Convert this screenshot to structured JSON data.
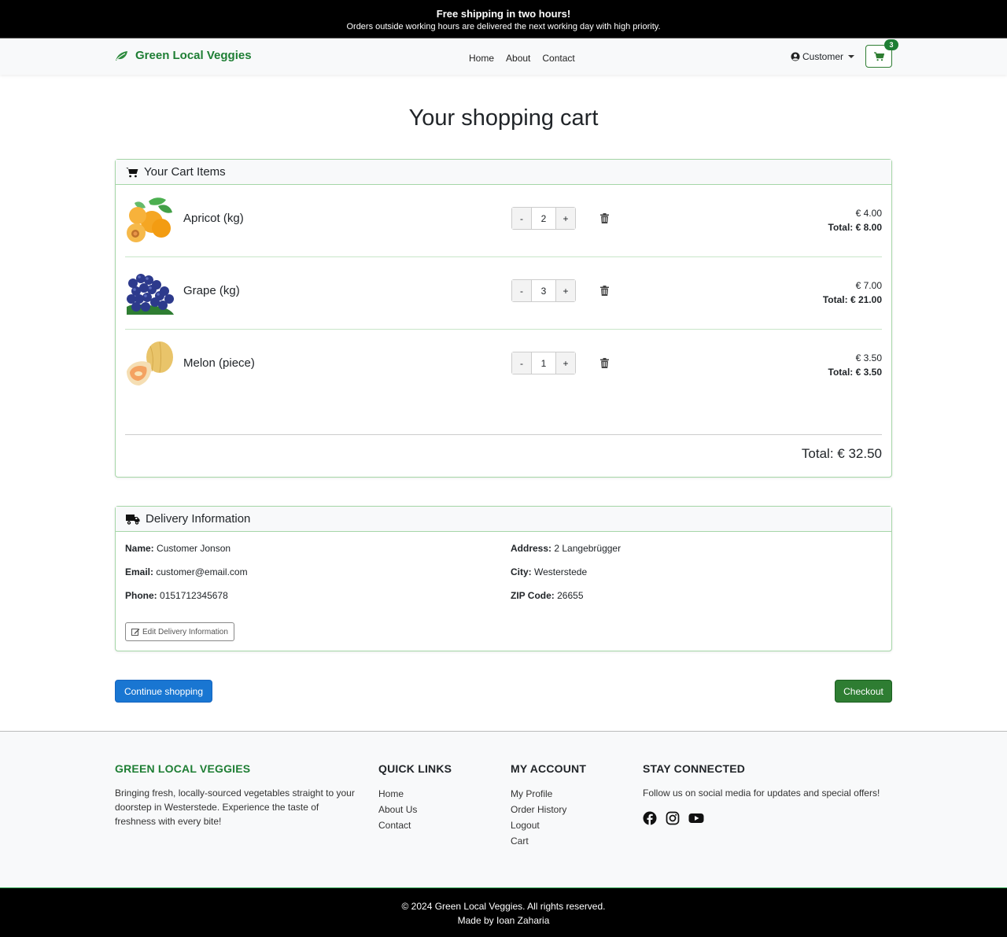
{
  "banner": {
    "headline": "Free shipping in two hours!",
    "note": "Orders outside working hours are delivered the next working day with high priority."
  },
  "navbar": {
    "brand": "Green Local Veggies",
    "links": [
      "Home",
      "About",
      "Contact"
    ],
    "account_label": "Customer",
    "cart_count": "3"
  },
  "page_title": "Your shopping cart",
  "cart": {
    "header": "Your Cart Items",
    "items": [
      {
        "name": "Apricot (kg)",
        "qty": "2",
        "unit_price": "€ 4.00",
        "total_label": "Total:",
        "total": "€ 8.00"
      },
      {
        "name": "Grape (kg)",
        "qty": "3",
        "unit_price": "€ 7.00",
        "total_label": "Total:",
        "total": "€ 21.00"
      },
      {
        "name": "Melon (piece)",
        "qty": "1",
        "unit_price": "€ 3.50",
        "total_label": "Total:",
        "total": "€ 3.50"
      }
    ],
    "minus": "-",
    "plus": "+",
    "grand_total": "Total: € 32.50"
  },
  "delivery": {
    "header": "Delivery Information",
    "name_label": "Name:",
    "name": "Customer Jonson",
    "email_label": "Email:",
    "email": "customer@email.com",
    "phone_label": "Phone:",
    "phone": "0151712345678",
    "address_label": "Address:",
    "address": "2 Langebrügger",
    "city_label": "City:",
    "city": "Westerstede",
    "zip_label": "ZIP Code:",
    "zip": "26655",
    "edit_button": "Edit Delivery Information"
  },
  "actions": {
    "continue": "Continue shopping",
    "checkout": "Checkout"
  },
  "footer": {
    "brand": "GREEN LOCAL VEGGIES",
    "about": "Bringing fresh, locally-sourced vegetables straight to your doorstep in Westerstede. Experience the taste of freshness with every bite!",
    "quick_links_title": "QUICK LINKS",
    "quick_links": [
      "Home",
      "About Us",
      "Contact"
    ],
    "account_title": "MY ACCOUNT",
    "account_links": [
      "My Profile",
      "Order History",
      "Logout",
      "Cart"
    ],
    "connected_title": "STAY CONNECTED",
    "connected_text": "Follow us on social media for updates and special offers!",
    "copyright": "© 2024 Green Local Veggies. All rights reserved.",
    "made_by": "Made by Ioan Zaharia"
  },
  "colors": {
    "brand_green": "#1e7e34",
    "primary_blue": "#1976d2",
    "checkout_green": "#2e7d32"
  },
  "icons": [
    "leaf-icon",
    "user-circle-icon",
    "cart-icon",
    "trash-icon",
    "truck-icon",
    "edit-icon",
    "facebook-icon",
    "instagram-icon",
    "youtube-icon"
  ]
}
